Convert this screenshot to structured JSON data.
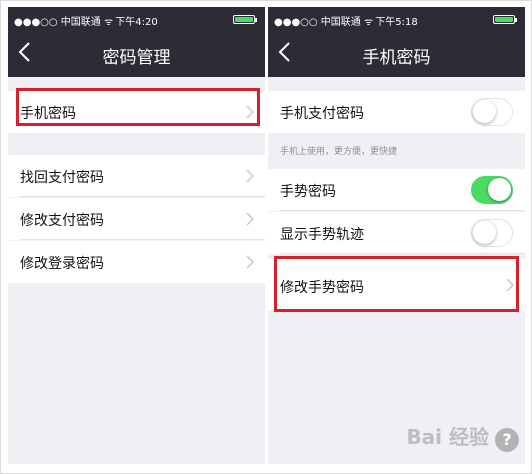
{
  "left": {
    "status": {
      "signal": "●●●○○ 中国联通 ᯤ",
      "time": "下午4:20"
    },
    "title": "密码管理",
    "items": [
      {
        "label": "手机密码"
      },
      {
        "label": "找回支付密码"
      },
      {
        "label": "修改支付密码"
      },
      {
        "label": "修改登录密码"
      }
    ]
  },
  "right": {
    "status": {
      "signal": "●●●○○ 中国联通 ᯤ",
      "time": "下午5:18"
    },
    "title": "手机密码",
    "items": [
      {
        "label": "手机支付密码",
        "toggle": false
      },
      {
        "label": "手势密码",
        "toggle": true
      },
      {
        "label": "显示手势轨迹",
        "toggle": false
      },
      {
        "label": "修改手势密码"
      }
    ],
    "hint": "手机上使用，更方便，更快捷"
  },
  "watermark": {
    "text": "Bai 经验",
    "badge": "?"
  },
  "colors": {
    "navbar": "#2b2c36",
    "highlight": "#d9202a",
    "switch_on": "#4cd964",
    "background": "#efeff4"
  }
}
